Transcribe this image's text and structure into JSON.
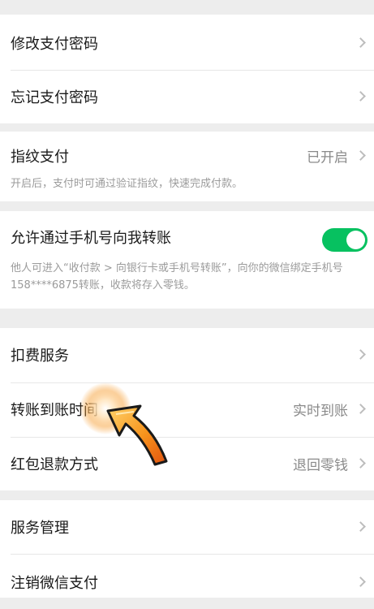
{
  "security": {
    "change_password": "修改支付密码",
    "forgot_password": "忘记支付密码"
  },
  "fingerprint": {
    "label": "指纹支付",
    "status": "已开启",
    "description": "开启后，支付时可通过验证指纹，快速完成付款。"
  },
  "phone_transfer": {
    "label": "允许通过手机号向我转账",
    "enabled": true,
    "description": "他人可进入“收付款 > 向银行卡或手机号转账”，向你的微信绑定手机号158****6875转账，收款将存入零钱。"
  },
  "services": {
    "deduction": "扣费服务",
    "transfer_time_label": "转账到账时间",
    "transfer_time_value": "实时到账",
    "red_packet_refund_label": "红包退款方式",
    "red_packet_refund_value": "退回零钱"
  },
  "manage": {
    "service_management": "服务管理",
    "deregister": "注销微信支付"
  },
  "colors": {
    "background": "#ededed",
    "toggle_on": "#07c160",
    "pointer_orange": "#f7941d"
  }
}
